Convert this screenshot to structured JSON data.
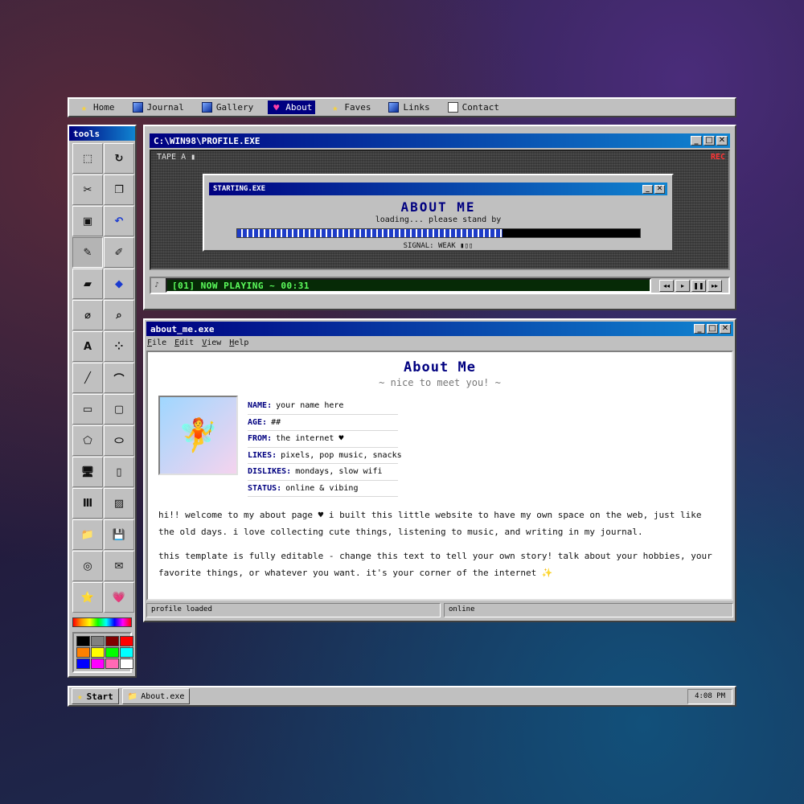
{
  "nav": {
    "items": [
      {
        "label": "Home",
        "icon": "star-icon",
        "active": false
      },
      {
        "label": "Journal",
        "icon": "folder-icon",
        "active": false
      },
      {
        "label": "Gallery",
        "icon": "folder-icon",
        "active": false
      },
      {
        "label": "About",
        "icon": "heart-icon",
        "active": true
      },
      {
        "label": "Faves",
        "icon": "star-icon",
        "active": false
      },
      {
        "label": "Links",
        "icon": "folder-icon",
        "active": false
      },
      {
        "label": "Contact",
        "icon": "blank-page-icon",
        "active": false
      }
    ]
  },
  "tools": {
    "title": "tools",
    "items": [
      {
        "name": "select-rect-icon",
        "glyph": "⬚"
      },
      {
        "name": "lasso-icon",
        "glyph": "↻"
      },
      {
        "name": "scissors-icon",
        "glyph": "✂"
      },
      {
        "name": "copy-icon",
        "glyph": "❐"
      },
      {
        "name": "paste-icon",
        "glyph": "▣"
      },
      {
        "name": "undo-icon",
        "glyph": "↶"
      },
      {
        "name": "pencil-icon",
        "glyph": "✎"
      },
      {
        "name": "brush-icon",
        "glyph": "✐"
      },
      {
        "name": "eraser-icon",
        "glyph": "▰"
      },
      {
        "name": "fill-bucket-icon",
        "glyph": "◆"
      },
      {
        "name": "eyedropper-icon",
        "glyph": "⌀"
      },
      {
        "name": "magnifier-icon",
        "glyph": "⌕"
      },
      {
        "name": "text-tool-icon",
        "glyph": "A"
      },
      {
        "name": "spray-icon",
        "glyph": "⁘"
      },
      {
        "name": "line-icon",
        "glyph": "╱"
      },
      {
        "name": "curve-icon",
        "glyph": "⌒"
      },
      {
        "name": "rectangle-icon",
        "glyph": "▭"
      },
      {
        "name": "rounded-rect-icon",
        "glyph": "▢"
      },
      {
        "name": "polygon-icon",
        "glyph": "⬠"
      },
      {
        "name": "ellipse-icon",
        "glyph": "⬭"
      },
      {
        "name": "computer-icon",
        "glyph": "🖥"
      },
      {
        "name": "device-icon",
        "glyph": "▯"
      },
      {
        "name": "columns-icon",
        "glyph": "Ⅲ"
      },
      {
        "name": "image-icon",
        "glyph": "▨"
      },
      {
        "name": "folder-icon",
        "glyph": "📁"
      },
      {
        "name": "save-icon",
        "glyph": "💾"
      },
      {
        "name": "disc-icon",
        "glyph": "◎"
      },
      {
        "name": "mail-icon",
        "glyph": "✉"
      },
      {
        "name": "star-icon",
        "glyph": "⭐"
      },
      {
        "name": "heart-icon",
        "glyph": "💗"
      }
    ],
    "palette": [
      "#000000",
      "#808080",
      "#800000",
      "#ff0000",
      "#ff8000",
      "#ffff00",
      "#00ff00",
      "#00ffff",
      "#0000ff",
      "#ff00ff",
      "#ff69b4",
      "#ffffff"
    ]
  },
  "profile_window": {
    "title": "C:\\WIN98\\PROFILE.EXE",
    "tape_label": "TAPE A ▮",
    "rec_label": "REC",
    "dialog": {
      "title": "STARTING.EXE",
      "heading": "ABOUT ME",
      "subtitle": "loading... please stand by",
      "progress": 0.66,
      "signal": "SIGNAL: WEAK ▮▯▯"
    },
    "now_playing": "[01] NOW PLAYING ~ 00:31",
    "controls": [
      "◂◂",
      "▸",
      "❚❚",
      "▸▸"
    ]
  },
  "about_window": {
    "title": "about_me.exe",
    "menu": {
      "file": "File",
      "edit": "Edit",
      "view": "View",
      "help": "Help"
    },
    "heading": "About Me",
    "subheading": "~ nice to meet you! ~",
    "avatar_emoji": "🧚",
    "facts": [
      {
        "key": "NAME:",
        "value": "your name here"
      },
      {
        "key": "AGE:",
        "value": "##"
      },
      {
        "key": "FROM:",
        "value": "the internet ♥"
      },
      {
        "key": "LIKES:",
        "value": "pixels, pop music, snacks"
      },
      {
        "key": "DISLIKES:",
        "value": "mondays, slow wifi"
      },
      {
        "key": "STATUS:",
        "value": "online & vibing"
      }
    ],
    "paragraph1": "hi!! welcome to my about page ♥ i built this little website to have my own space on the web, just like the old days. i love collecting cute things, listening to music, and writing in my journal.",
    "paragraph2": "this template is fully editable - change this text to tell your own story! talk about your hobbies, your favorite things, or whatever you want. it's your corner of the internet ✨",
    "status_left": "profile loaded",
    "status_right": "online"
  },
  "taskbar": {
    "start_label": "Start",
    "task_label": "About.exe",
    "clock": "4:08 PM"
  },
  "colors": {
    "title_gradient_start": "#000080",
    "title_gradient_end": "#1084d0",
    "window_face": "#c0c0c0",
    "lcd_text": "#5dff5d",
    "accent_navy": "#000080"
  }
}
